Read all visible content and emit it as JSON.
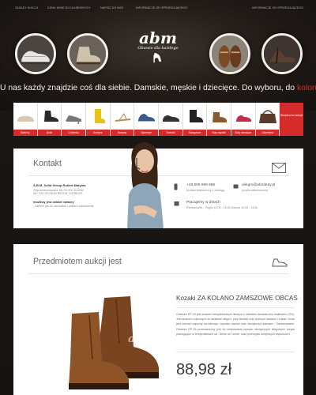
{
  "nav": {
    "items": [
      "Zasady aukcji",
      "Dział wnie do ulubionych",
      "Napisz do nas",
      "Informacje od sprzedającego",
      "Informacje od sprzedającego"
    ]
  },
  "logo": {
    "brand": "abm",
    "tag": "Obuwie dla każdego"
  },
  "tagline": {
    "before": "U nas każdy znajdzie coś dla siebie. Damskie, męskie i dziecięce. Do wyboru, do ",
    "accent": "koloru",
    "after": "."
  },
  "categories": [
    {
      "label": "Baleriny",
      "icon": "ballet-flat-icon",
      "color": "#d9c9b0"
    },
    {
      "label": "Botki",
      "icon": "ankle-boot-icon",
      "color": "#2a2a2a"
    },
    {
      "label": "Czółenka",
      "icon": "pump-icon",
      "color": "#777777"
    },
    {
      "label": "Kalosze",
      "icon": "rain-boot-icon",
      "color": "#e8c418"
    },
    {
      "label": "Sandały",
      "icon": "sandal-icon",
      "color": "#b98a5a"
    },
    {
      "label": "Sportowe",
      "icon": "sneaker-icon",
      "color": "#3a5a8a"
    },
    {
      "label": "Trzewiki",
      "icon": "shoe-icon",
      "color": "#333333"
    },
    {
      "label": "Śniegowce",
      "icon": "snow-boot-icon",
      "color": "#222222"
    },
    {
      "label": "Buty męskie",
      "icon": "mens-boot-icon",
      "color": "#8a5a30"
    },
    {
      "label": "Buty dziecięce",
      "icon": "kids-shoe-icon",
      "color": "#c0304a"
    },
    {
      "label": "Galanteria",
      "icon": "handbag-icon",
      "color": "#5a3a2a"
    }
  ],
  "categories_more": "Bezpieczne aukcje",
  "contact": {
    "title": "Kontakt",
    "company": "A.B.M. Solid Group Robert Matynia",
    "address": "Starowarszawska 8A 29-200 Kolbiel",
    "nip": "NIP: 534-191-98-83 REGON: 141385129",
    "pickup_title": "możliwy jest odbiór własny",
    "pickup_note": "- odbierz jak do nas trafisz i odbierz zamówienie",
    "phone": "+48 609 996 996",
    "phone_label": "kontakt telefoniczny z obsługą",
    "email": "allegro@abmbuty.pl",
    "email_label": "poczta elektroniczna",
    "hours_title": "Pracujemy w dniach",
    "hours": "Poniedziałek - Piątek 10:00 - 18:00   Sobota 10:00 - 14:00"
  },
  "product": {
    "section_title": "Przedmiotem aukcji jest",
    "name": "Kozaki ZA KOLANO ZAMSZOWE OBCAS",
    "description": "Greesen EP-25 jest smarem kompleksowym litowym z udziałem dwusiarczku molibdenu (3%). Jest smarem odpornym na działanie wilgoci, przy wielkiej oraz dobrych kwasów i zasad. Smar jest również odporny na wibracje, wysokie naciski oraz obciążenia udarowe. / Zastosowanie: Greesen EP-25 przeznaczony jest do smarowania wysoko obciążonych ślizgowych łożysk pracujących w temperaturach od . Silnie do i zimie, oraz przemysłu kolejowych wykonczeń.",
    "price": "88,98 zł",
    "watermark": "abm"
  },
  "colors": {
    "accent": "#d62b2b",
    "panel": "#ffffff",
    "background": "#1c1714"
  }
}
